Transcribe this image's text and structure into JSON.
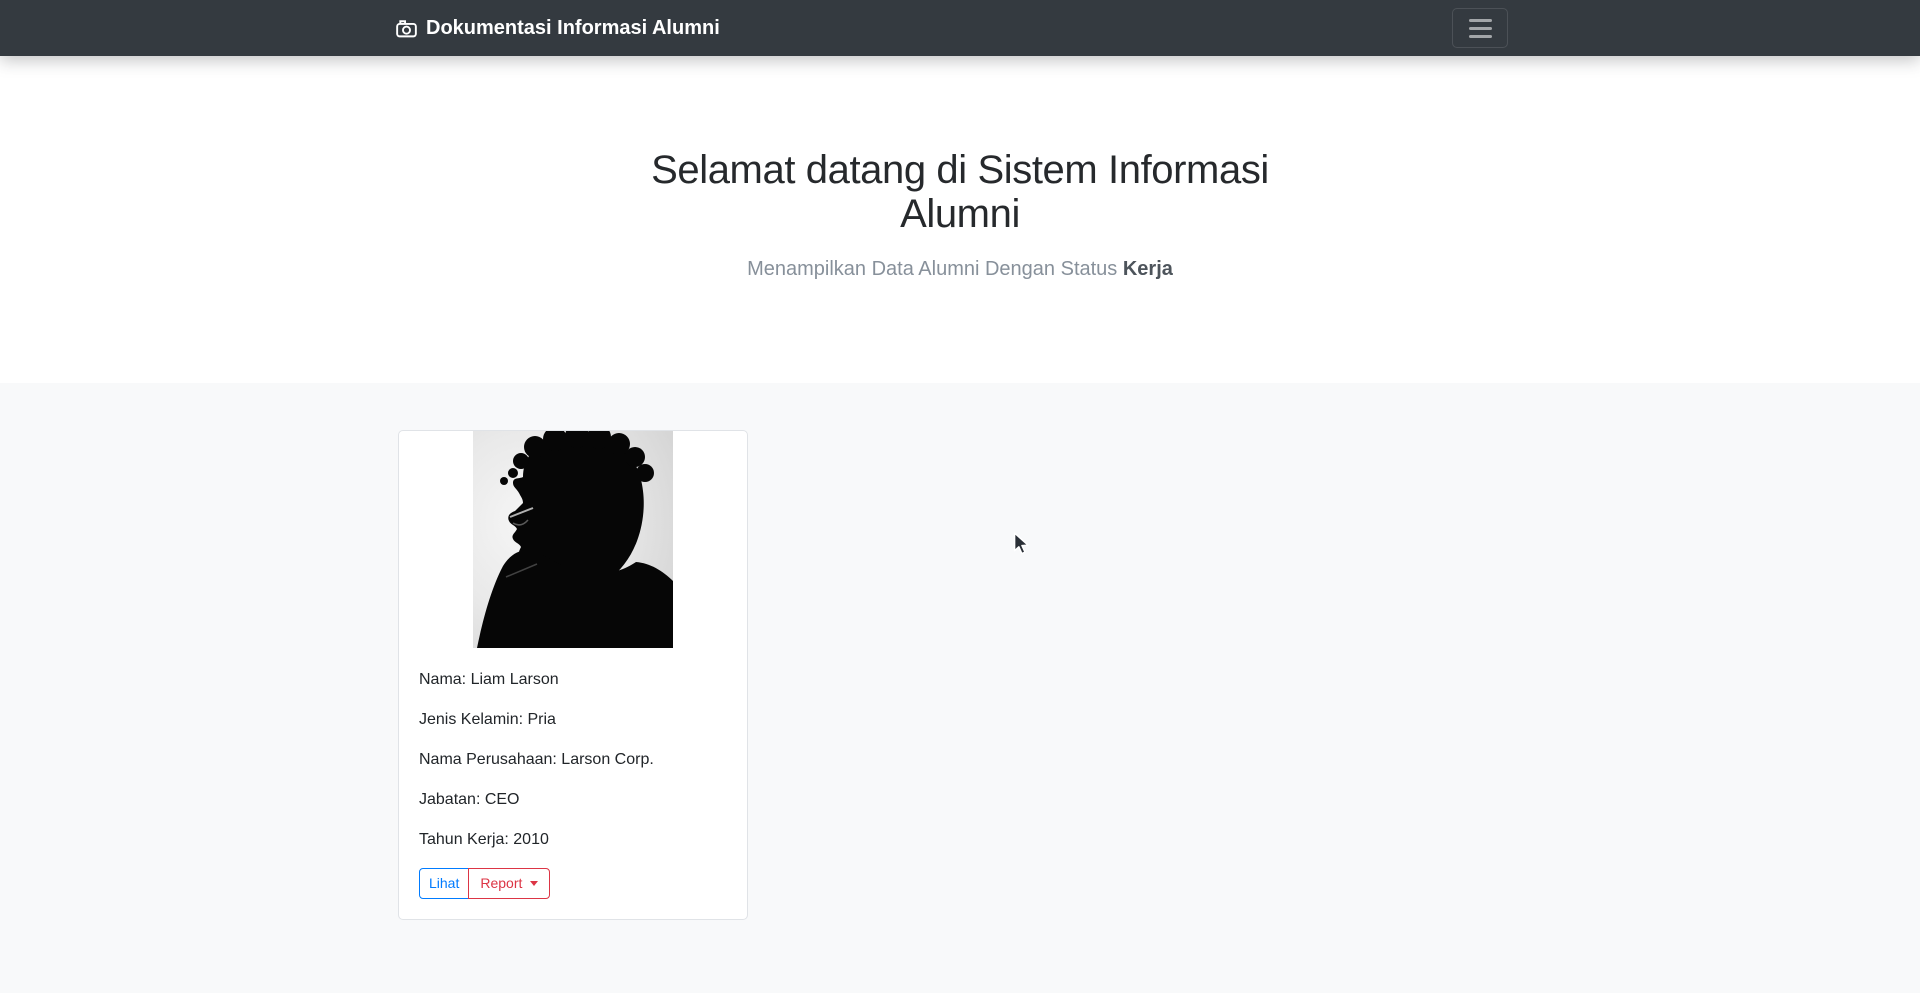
{
  "navbar": {
    "brand_label": "Dokumentasi Informasi Alumni",
    "brand_icon": "camera-icon",
    "toggler_icon": "hamburger-menu-icon",
    "bg_color": "#343a40"
  },
  "hero": {
    "title_line1": "Selamat datang di Sistem Informasi",
    "title_line2": "Alumni",
    "subtitle_prefix": "Menampilkan Data Alumni Dengan Status ",
    "subtitle_status": "Kerja"
  },
  "alumni_card": {
    "photo_icon": "male-silhouette-portrait",
    "lines": [
      "Nama: Liam Larson",
      "Jenis Kelamin: Pria",
      "Nama Perusahaan: Larson Corp.",
      "Jabatan: CEO",
      "Tahun Kerja: 2010"
    ],
    "buttons": {
      "lihat_label": "Lihat",
      "report_label": "Report",
      "report_caret_icon": "caret-down-icon"
    }
  },
  "colors": {
    "navbar_bg": "#343a40",
    "section_bg": "#f8f9fa",
    "primary": "#007bff",
    "danger": "#dc3545",
    "text": "#212529",
    "muted": "#87909a"
  }
}
